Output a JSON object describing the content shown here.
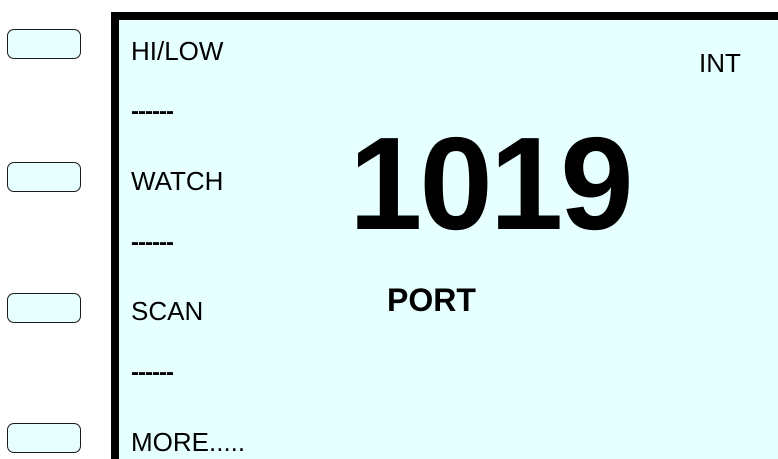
{
  "softkeys": [
    {
      "name": "softkey-1"
    },
    {
      "name": "softkey-2"
    },
    {
      "name": "softkey-3"
    },
    {
      "name": "softkey-4"
    }
  ],
  "menu": {
    "hi_low": "HI/LOW",
    "sep1": "------",
    "watch": "WATCH",
    "sep2": "------",
    "scan": "SCAN",
    "sep3": "------",
    "more": "MORE....."
  },
  "display": {
    "mode": "INT",
    "channel": "1019",
    "location": "PORT"
  },
  "colors": {
    "lcd_background": "#e6ffff",
    "bezel": "#000000",
    "softkey_fill": "#e8ffff"
  }
}
